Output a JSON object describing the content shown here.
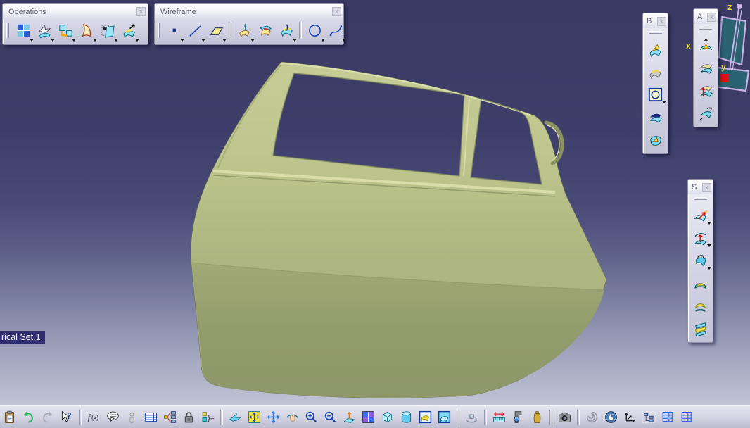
{
  "viewport": {
    "geo_set_label": "rical Set.1"
  },
  "compass": {
    "x_label": "x",
    "y_label": "y",
    "z_label": "z"
  },
  "colors": {
    "viewport_top": "#3a3a64",
    "viewport_bottom": "#c2c5d6",
    "door_light": "#c3c993",
    "door_dark": "#8c9566",
    "compass_outline": "#cbb4e8",
    "compass_plane": "#2a6272",
    "compass_origin": "#e01010",
    "axis_label": "#e8e020",
    "toolbar_face": "#d8d8e8",
    "label_bg": "#2e2e70"
  },
  "toolbars": {
    "operations": {
      "title": "Operations",
      "close_label": "x",
      "buttons": [
        {
          "name": "join",
          "dropdown": true
        },
        {
          "name": "trim",
          "dropdown": true
        },
        {
          "name": "transform-cubes",
          "dropdown": true
        },
        {
          "name": "shape-fillet",
          "dropdown": true
        },
        {
          "name": "split-plane",
          "dropdown": true
        },
        {
          "name": "extrapolate",
          "dropdown": true
        }
      ]
    },
    "wireframe": {
      "title": "Wireframe",
      "close_label": "x",
      "buttons": [
        {
          "name": "point",
          "dropdown": true
        },
        {
          "name": "line",
          "dropdown": true
        },
        {
          "name": "plane",
          "dropdown": true
        },
        {
          "sep": true
        },
        {
          "name": "projection",
          "dropdown": true
        },
        {
          "name": "intersection",
          "dropdown": false
        },
        {
          "name": "reflect-line",
          "dropdown": true
        },
        {
          "sep": true
        },
        {
          "name": "circle",
          "dropdown": true
        },
        {
          "name": "spline",
          "dropdown": true
        }
      ]
    },
    "b_palette": {
      "title": "B",
      "close_label": "x",
      "buttons": [
        {
          "name": "extrude-surface",
          "dropdown": false
        },
        {
          "name": "revolve-surface",
          "dropdown": false
        },
        {
          "name": "sphere-surface",
          "dropdown": true
        },
        {
          "name": "sweep-surface",
          "dropdown": false
        },
        {
          "name": "fill-surface",
          "dropdown": false
        }
      ]
    },
    "a_palette": {
      "title": "A",
      "close_label": "x",
      "buttons": [
        {
          "name": "dome-arrow",
          "dropdown": false
        },
        {
          "name": "offset-stack",
          "dropdown": false
        },
        {
          "name": "surface-red-arrow",
          "dropdown": false
        },
        {
          "name": "surface-rotate",
          "dropdown": false
        }
      ]
    },
    "s_palette": {
      "title": "S",
      "close_label": "x",
      "buttons": [
        {
          "name": "offset-arrow",
          "dropdown": true
        },
        {
          "name": "mid-red-arrow",
          "dropdown": true
        },
        {
          "name": "flip-surface",
          "dropdown": true
        },
        {
          "name": "dome-surface",
          "dropdown": false
        },
        {
          "name": "crescent-surface",
          "dropdown": false
        },
        {
          "name": "layered-surface",
          "dropdown": false
        }
      ]
    },
    "bottom": {
      "items": [
        {
          "name": "paste"
        },
        {
          "name": "undo"
        },
        {
          "name": "redo"
        },
        {
          "name": "whats-this"
        },
        {
          "sep": true
        },
        {
          "name": "formula"
        },
        {
          "name": "chat"
        },
        {
          "name": "catalog-gray"
        },
        {
          "name": "table"
        },
        {
          "name": "links"
        },
        {
          "name": "lock"
        },
        {
          "name": "set-equal"
        },
        {
          "sep": true
        },
        {
          "name": "fly"
        },
        {
          "name": "fit-all"
        },
        {
          "name": "pan"
        },
        {
          "name": "rotate-hand"
        },
        {
          "name": "zoom-in"
        },
        {
          "name": "zoom-out"
        },
        {
          "name": "normal-view"
        },
        {
          "name": "quad-view"
        },
        {
          "name": "iso-cube"
        },
        {
          "name": "cylinder-shade"
        },
        {
          "name": "shade-material"
        },
        {
          "name": "shade-edges"
        },
        {
          "sep": true
        },
        {
          "name": "turntable"
        },
        {
          "sep": true
        },
        {
          "name": "ruler-measure"
        },
        {
          "name": "caliper-measure"
        },
        {
          "name": "weight-inertia"
        },
        {
          "sep": true
        },
        {
          "name": "camera-capture"
        },
        {
          "sep": true
        },
        {
          "name": "swirl"
        },
        {
          "name": "globe-hand"
        },
        {
          "name": "axis-triad"
        },
        {
          "name": "tree-select"
        },
        {
          "name": "grid-blue"
        },
        {
          "name": "grid-partial"
        }
      ]
    }
  }
}
